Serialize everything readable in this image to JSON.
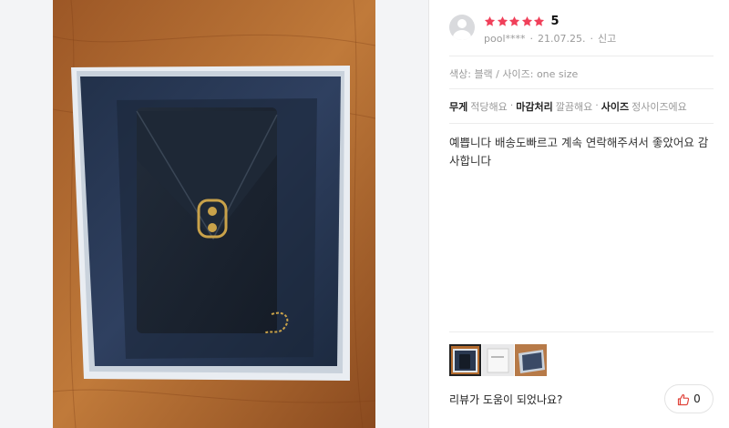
{
  "review": {
    "rating": 5,
    "rating_label": "5",
    "author": "pool****",
    "date": "21.07.25.",
    "report_label": "신고",
    "options": "색상: 블랙 / 사이즈: one size",
    "attributes": [
      {
        "key": "무게",
        "value": "적당해요"
      },
      {
        "key": "마감처리",
        "value": "깔끔해요"
      },
      {
        "key": "사이즈",
        "value": "정사이즈에요"
      }
    ],
    "text": "예쁩니다 배송도빠르고 계속 연락해주셔서 좋았어요 감사합니다",
    "helpful_question": "리뷰가 도움이 되었나요?",
    "like_count": "0"
  },
  "colors": {
    "star": "#f0405a",
    "like_icon": "#e0453c",
    "bag": "#1b2430",
    "box_inner": "#2a3850",
    "wood": "#b36b2e",
    "hardware": "#c9a24a"
  },
  "icons": {
    "avatar": "user-avatar-icon",
    "star": "star-icon",
    "like": "thumbs-up-icon"
  }
}
